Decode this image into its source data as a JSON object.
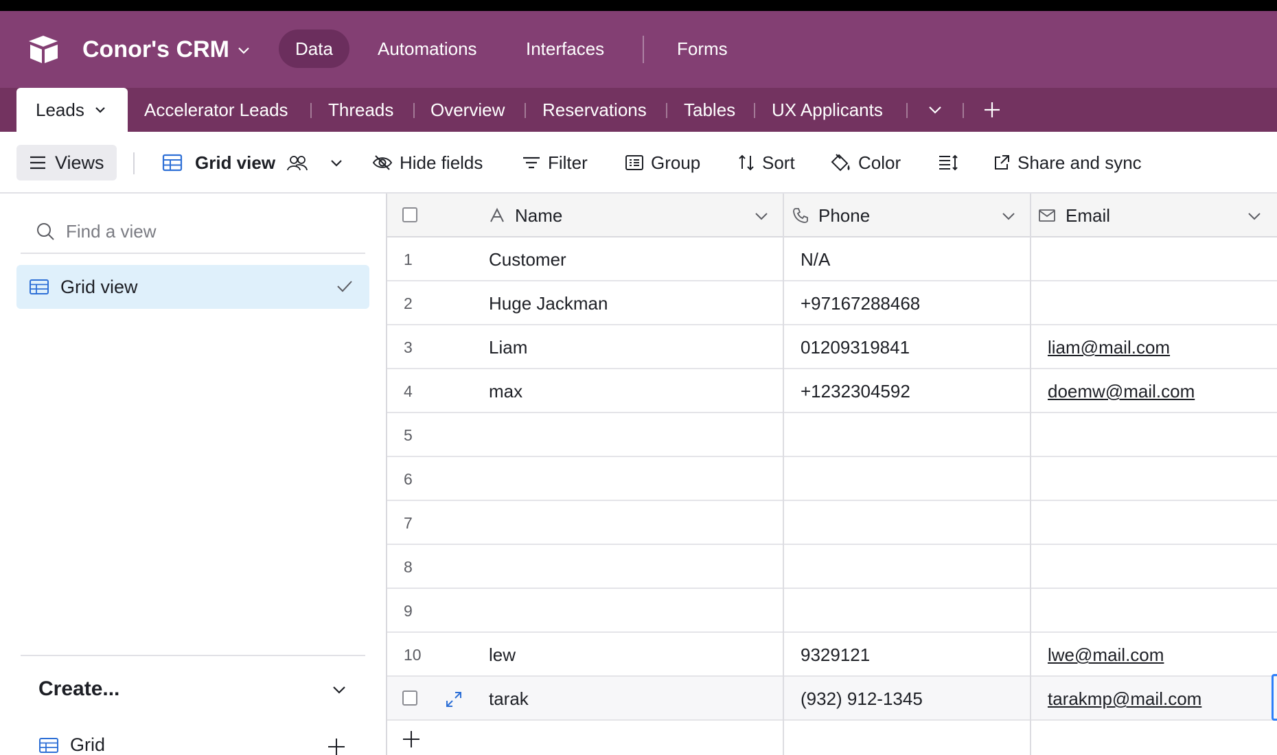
{
  "app": {
    "base_name": "Conor's CRM",
    "nav": [
      "Data",
      "Automations",
      "Interfaces",
      "Forms"
    ],
    "active_nav": "Data",
    "header_color": "#833f73"
  },
  "tables": {
    "active": "Leads",
    "others": [
      "Accelerator Leads",
      "Threads",
      "Overview",
      "Reservations",
      "Tables",
      "UX Applicants"
    ]
  },
  "toolbar": {
    "views": "Views",
    "view_name": "Grid view",
    "hide_fields": "Hide fields",
    "filter": "Filter",
    "group": "Group",
    "sort": "Sort",
    "color": "Color",
    "share": "Share and sync"
  },
  "sidebar": {
    "search_placeholder": "Find a view",
    "views": [
      {
        "label": "Grid view",
        "selected": true
      }
    ],
    "create_label": "Create...",
    "create_items": [
      "Grid"
    ]
  },
  "grid": {
    "columns": [
      {
        "name": "Name",
        "icon": "text-field-icon"
      },
      {
        "name": "Phone",
        "icon": "phone-icon"
      },
      {
        "name": "Email",
        "icon": "envelope-icon"
      }
    ],
    "rows": [
      {
        "n": "1",
        "name": "Customer",
        "phone": "N/A",
        "email": ""
      },
      {
        "n": "2",
        "name": "Huge Jackman",
        "phone": "+97167288468",
        "email": ""
      },
      {
        "n": "3",
        "name": "Liam",
        "phone": "01209319841",
        "email": "liam@mail.com"
      },
      {
        "n": "4",
        "name": "max",
        "phone": "+1232304592",
        "email": "doemw@mail.com"
      },
      {
        "n": "5",
        "name": "",
        "phone": "",
        "email": ""
      },
      {
        "n": "6",
        "name": "",
        "phone": "",
        "email": ""
      },
      {
        "n": "7",
        "name": "",
        "phone": "",
        "email": ""
      },
      {
        "n": "8",
        "name": "",
        "phone": "",
        "email": ""
      },
      {
        "n": "9",
        "name": "",
        "phone": "",
        "email": ""
      },
      {
        "n": "10",
        "name": "lew",
        "phone": "9329121",
        "email": "lwe@mail.com"
      },
      {
        "n": "",
        "name": "tarak",
        "phone": "(932) 912-1345",
        "email": "tarakmp@mail.com",
        "hovered": true
      }
    ]
  }
}
